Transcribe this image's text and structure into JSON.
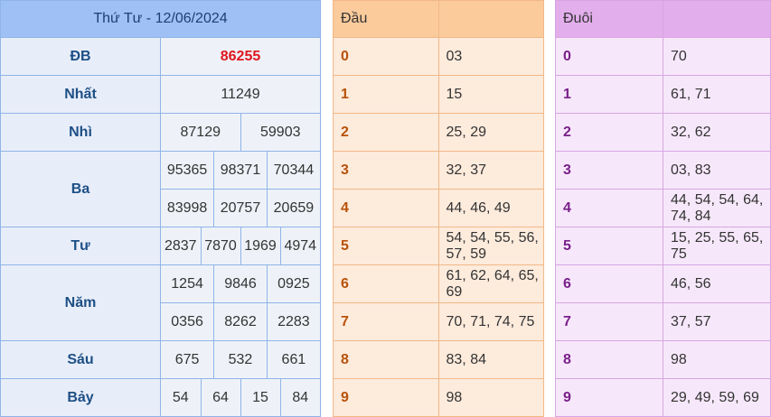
{
  "results": {
    "title": "Thứ Tư - 12/06/2024",
    "db": {
      "label": "ĐB",
      "value": "86255"
    },
    "nhat": {
      "label": "Nhất",
      "value": "11249"
    },
    "nhi": {
      "label": "Nhì",
      "values": [
        "87129",
        "59903"
      ]
    },
    "ba": {
      "label": "Ba",
      "values": [
        "95365",
        "98371",
        "70344",
        "83998",
        "20757",
        "20659"
      ]
    },
    "tu": {
      "label": "Tư",
      "values": [
        "2837",
        "7870",
        "1969",
        "4974"
      ]
    },
    "nam": {
      "label": "Năm",
      "values": [
        "1254",
        "9846",
        "0925",
        "0356",
        "8262",
        "2283"
      ]
    },
    "sau": {
      "label": "Sáu",
      "values": [
        "675",
        "532",
        "661"
      ]
    },
    "bay": {
      "label": "Bảy",
      "values": [
        "54",
        "64",
        "15",
        "84"
      ]
    }
  },
  "dau": {
    "header": "Đầu",
    "rows": [
      {
        "k": "0",
        "v": "03"
      },
      {
        "k": "1",
        "v": "15"
      },
      {
        "k": "2",
        "v": "25, 29"
      },
      {
        "k": "3",
        "v": "32, 37"
      },
      {
        "k": "4",
        "v": "44, 46, 49"
      },
      {
        "k": "5",
        "v": "54, 54, 55, 56, 57, 59"
      },
      {
        "k": "6",
        "v": "61, 62, 64, 65, 69"
      },
      {
        "k": "7",
        "v": "70, 71, 74, 75"
      },
      {
        "k": "8",
        "v": "83, 84"
      },
      {
        "k": "9",
        "v": "98"
      }
    ]
  },
  "duoi": {
    "header": "Đuôi",
    "rows": [
      {
        "k": "0",
        "v": "70"
      },
      {
        "k": "1",
        "v": "61, 71"
      },
      {
        "k": "2",
        "v": "32, 62"
      },
      {
        "k": "3",
        "v": "03, 83"
      },
      {
        "k": "4",
        "v": "44, 54, 54, 64, 74, 84"
      },
      {
        "k": "5",
        "v": "15, 25, 55, 65, 75"
      },
      {
        "k": "6",
        "v": "46, 56"
      },
      {
        "k": "7",
        "v": "37, 57"
      },
      {
        "k": "8",
        "v": "98"
      },
      {
        "k": "9",
        "v": "29, 49, 59, 69"
      }
    ]
  },
  "colors": {
    "db_value": "#e0161e",
    "dau_key": "#b8520a",
    "duoi_key": "#7a1f8a"
  }
}
